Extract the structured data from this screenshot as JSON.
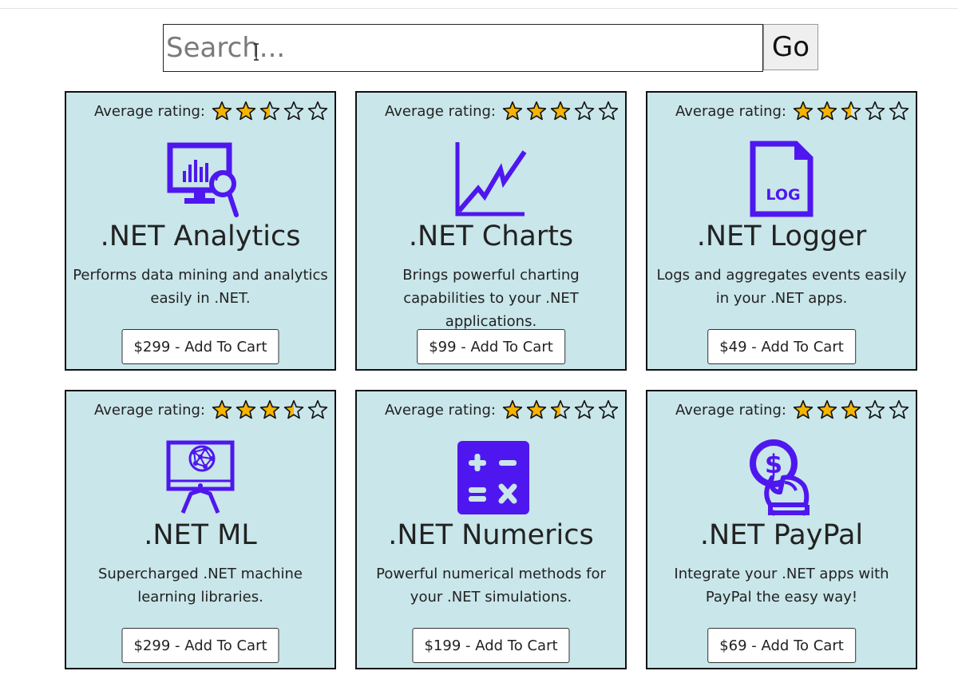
{
  "search": {
    "placeholder": "Search...",
    "go_label": "Go"
  },
  "colors": {
    "accent": "#4f17ef",
    "card_bg": "#c9e6ea",
    "star_fill": "#f5b400"
  },
  "rating_label": "Average rating:",
  "products": [
    {
      "name": ".NET Analytics",
      "description": "Performs data mining and analytics easily in .NET.",
      "cart_label": "$299 - Add To Cart",
      "rating": 2.5,
      "icon": "analytics-monitor-icon"
    },
    {
      "name": ".NET Charts",
      "description": "Brings powerful charting capabilities to your .NET applications.",
      "cart_label": "$99 - Add To Cart",
      "rating": 3,
      "icon": "line-chart-icon"
    },
    {
      "name": ".NET Logger",
      "description": "Logs and aggregates events easily in your .NET apps.",
      "cart_label": "$49 - Add To Cart",
      "rating": 2.5,
      "icon": "log-file-icon",
      "icon_text": "LOG"
    },
    {
      "name": ".NET ML",
      "description": "Supercharged .NET machine learning libraries.",
      "cart_label": "$299 - Add To Cart",
      "rating": 3.5,
      "icon": "machine-learning-brain-icon"
    },
    {
      "name": ".NET Numerics",
      "description": "Powerful numerical methods for your .NET simulations.",
      "cart_label": "$199 - Add To Cart",
      "rating": 2.5,
      "icon": "calculator-icon"
    },
    {
      "name": ".NET PayPal",
      "description": "Integrate your .NET apps with PayPal the easy way!",
      "cart_label": "$69 - Add To Cart",
      "rating": 3,
      "icon": "hand-money-icon"
    }
  ]
}
